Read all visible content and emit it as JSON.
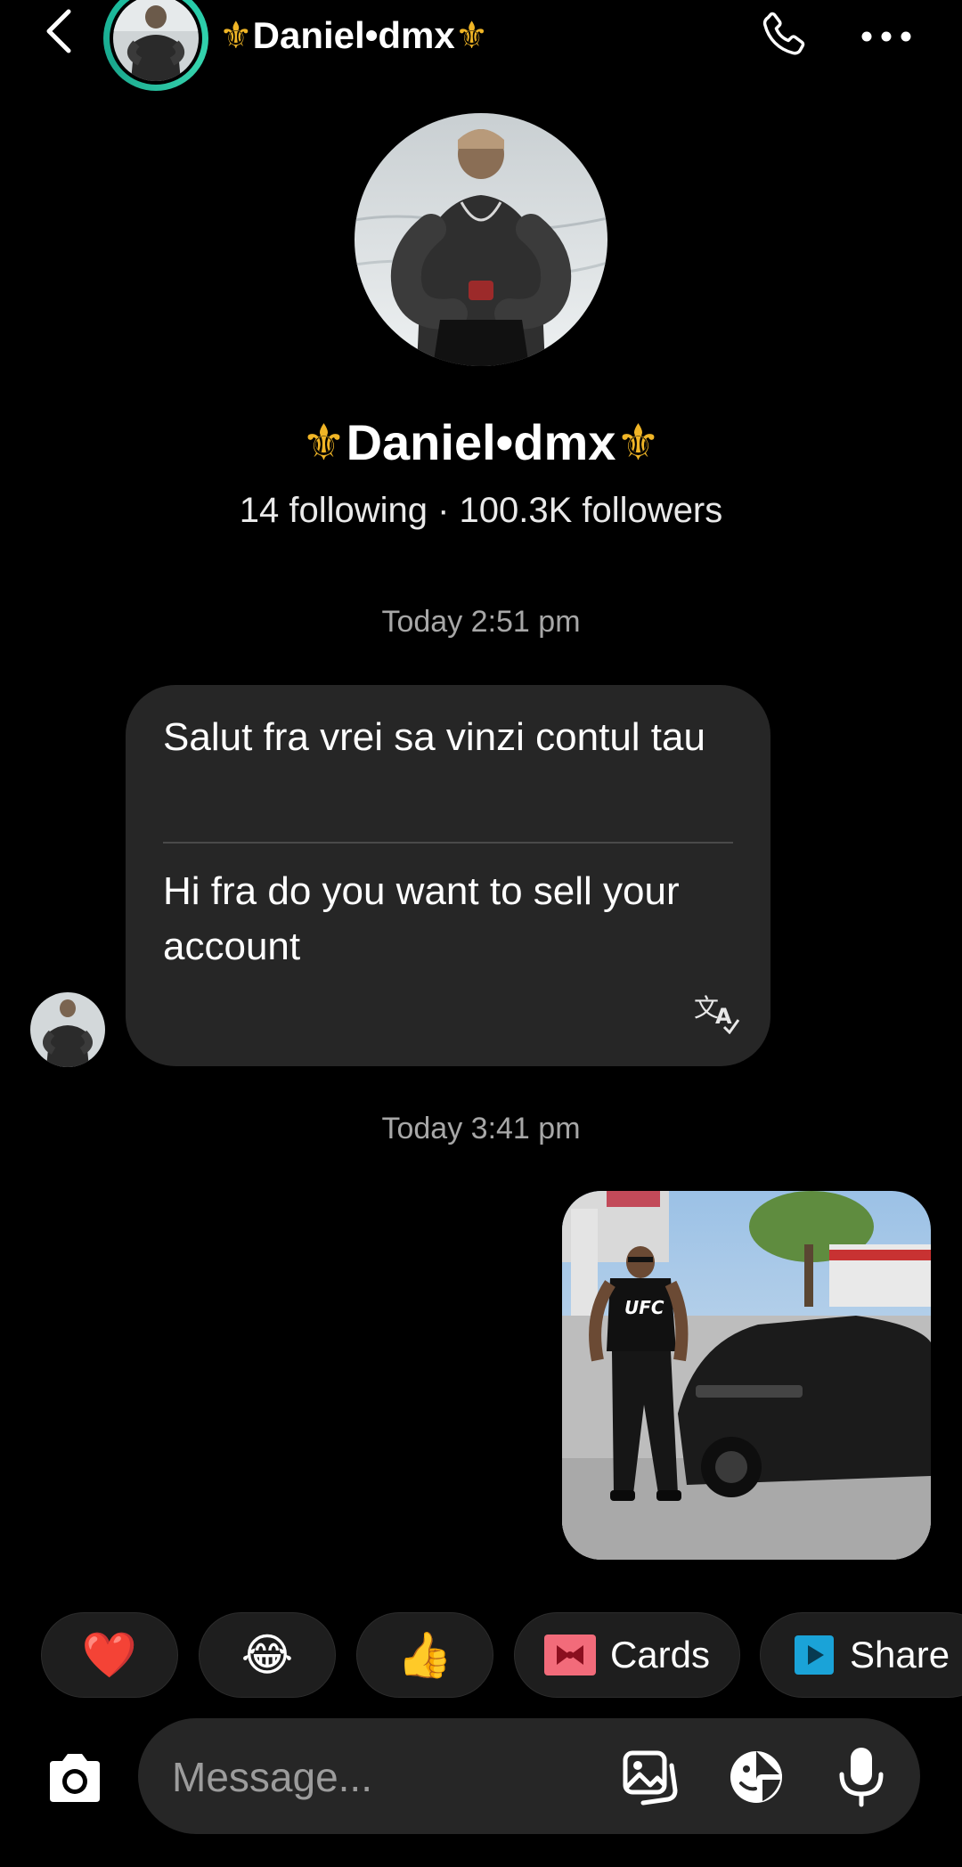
{
  "header": {
    "username": "Daniel•dmx",
    "fleur_symbol": "⚜",
    "back_icon": "chevron-left-icon",
    "call_icon": "phone-icon",
    "menu_icon": "more-horizontal-icon",
    "story_ring_color": "#1ec7a7"
  },
  "profile": {
    "name": "Daniel•dmx",
    "stats": "14 following · 100.3K followers"
  },
  "thread": {
    "timestamp_1": "Today 2:51 pm",
    "incoming_message": {
      "original": "Salut fra vrei sa vinzi contul tau",
      "translation": "Hi fra do you want to sell your account",
      "translate_icon": "translate-icon"
    },
    "timestamp_2": "Today 3:41 pm",
    "sent_photo_icon": "photo-thumbnail"
  },
  "quick_replies": {
    "heart": "❤️",
    "laugh": "😂",
    "thumbs_up": "👍",
    "cards_label": "Cards",
    "share_label": "Share",
    "cards_icon": "gift-card-icon",
    "share_icon": "play-share-icon"
  },
  "composer": {
    "placeholder": "Message...",
    "camera_icon": "camera-icon",
    "gallery_icon": "gallery-icon",
    "sticker_icon": "sticker-icon",
    "mic_icon": "microphone-icon"
  },
  "colors": {
    "background": "#000000",
    "bubble": "#262626",
    "accent_gold": "#f0b526",
    "muted_text": "#a7a7a7"
  }
}
